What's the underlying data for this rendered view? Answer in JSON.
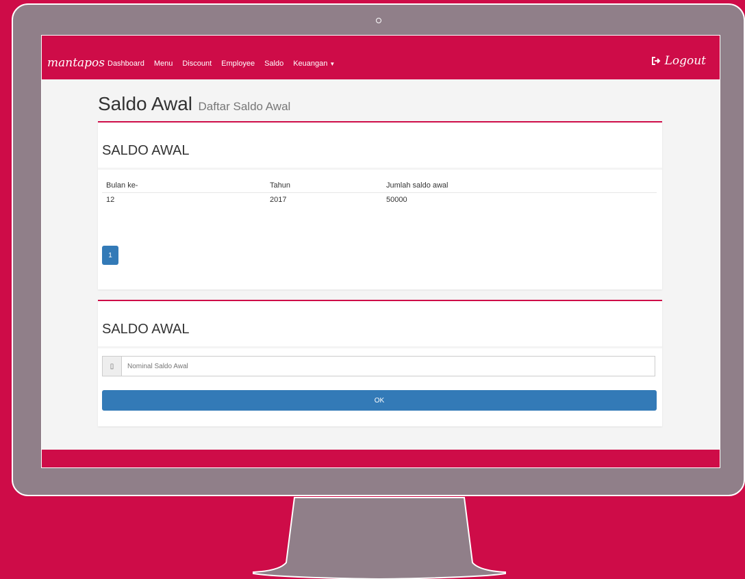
{
  "navbar": {
    "brand": "mantapos",
    "links": [
      "Dashboard",
      "Menu",
      "Discount",
      "Employee",
      "Saldo",
      "Keuangan"
    ],
    "logout_label": "Logout"
  },
  "page": {
    "title": "Saldo Awal",
    "subtitle": "Daftar Saldo Awal"
  },
  "list_box": {
    "title": "SALDO AWAL",
    "columns": [
      "Bulan ke-",
      "Tahun",
      "Jumlah saldo awal"
    ],
    "rows": [
      [
        "12",
        "2017",
        "50000"
      ]
    ],
    "pagination": [
      "1"
    ]
  },
  "form_box": {
    "title": "SALDO AWAL",
    "input_placeholder": "Nominal Saldo Awal",
    "submit_label": "OK"
  },
  "colors": {
    "brand": "#ce0c48",
    "primary_button": "#337ab7",
    "monitor_frame": "#907f89"
  },
  "icons": {
    "logout": "sign-out-icon",
    "input_addon": "money-icon",
    "dropdown": "caret-down-icon"
  }
}
